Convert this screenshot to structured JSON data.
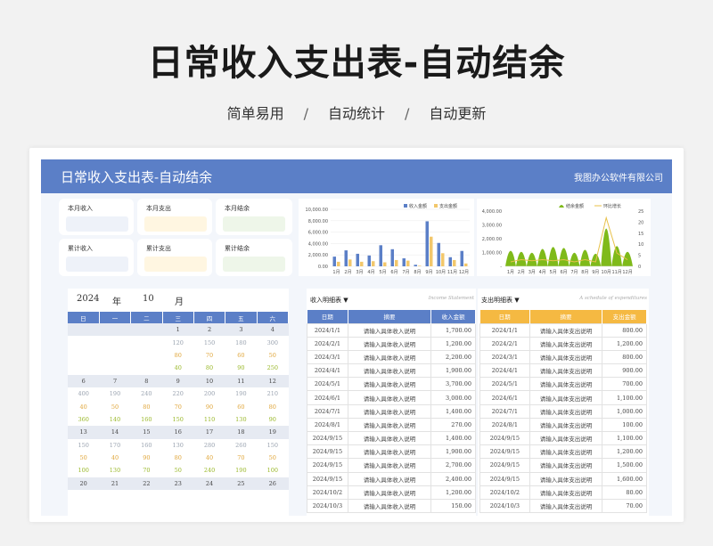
{
  "hero": {
    "title": "日常收入支出表-自动结余",
    "tags": [
      "简单易用",
      "自动统计",
      "自动更新"
    ],
    "sep": "/"
  },
  "banner": {
    "title": "日常收入支出表-自动结余",
    "company": "我图办公软件有限公司"
  },
  "cards": {
    "month_income": "本月收入",
    "month_expense": "本月支出",
    "month_balance": "本月结余",
    "total_income": "累计收入",
    "total_expense": "累计支出",
    "total_balance": "累计结余"
  },
  "colors": {
    "income": "#5b7fc7",
    "expense": "#f2c76b",
    "balance": "#7fba1a",
    "header_blue": "#5b7fc7",
    "header_orange": "#f5b942"
  },
  "chart_data": [
    {
      "type": "bar",
      "legend": [
        "收入金额",
        "支出金额"
      ],
      "categories": [
        "1月",
        "2月",
        "3月",
        "4月",
        "5月",
        "6月",
        "7月",
        "8月",
        "9月",
        "10月",
        "11月",
        "12月"
      ],
      "yticks": [
        "0.00",
        "2,000.00",
        "4,000.00",
        "6,000.00",
        "8,000.00",
        "10,000.00"
      ],
      "ylim": [
        0,
        10000
      ],
      "series": [
        {
          "name": "收入金额",
          "values": [
            1700,
            2800,
            2200,
            1900,
            3700,
            3000,
            1400,
            270,
            7900,
            4100,
            1600,
            2700
          ]
        },
        {
          "name": "支出金额",
          "values": [
            800,
            1200,
            800,
            900,
            700,
            1100,
            1000,
            100,
            5200,
            2300,
            1100,
            500
          ]
        }
      ]
    },
    {
      "type": "area",
      "legend": [
        "结余金额",
        "环比增长"
      ],
      "categories": [
        "1月",
        "2月",
        "3月",
        "4月",
        "5月",
        "6月",
        "7月",
        "8月",
        "9月",
        "10月",
        "11月",
        "12月"
      ],
      "yticks": [
        "-",
        "1,000.00",
        "2,000.00",
        "3,000.00",
        "4,000.00"
      ],
      "y2ticks": [
        "0",
        "5",
        "10",
        "15",
        "20",
        "25"
      ],
      "ylim": [
        0,
        4000
      ],
      "series": [
        {
          "name": "结余金额",
          "values": [
            1600,
            1500,
            1400,
            1800,
            2000,
            1900,
            1400,
            1700,
            1300,
            3900,
            2100,
            1500
          ]
        },
        {
          "name": "环比增长",
          "values": [
            2,
            3,
            2.5,
            3,
            2.5,
            3,
            2,
            3,
            2,
            22,
            6,
            3
          ]
        }
      ]
    }
  ],
  "calendar": {
    "year": "2024",
    "year_label": "年",
    "month": "10",
    "month_label": "月",
    "weekdays": [
      "日",
      "一",
      "二",
      "三",
      "四",
      "五",
      "六"
    ],
    "weeks": [
      {
        "days": [
          "",
          "",
          "",
          "1",
          "2",
          "3",
          "4"
        ],
        "a": [
          "",
          "",
          "",
          "120",
          "150",
          "180",
          "300"
        ],
        "b": [
          "",
          "",
          "",
          "80",
          "70",
          "60",
          "50"
        ],
        "c": [
          "",
          "",
          "",
          "40",
          "80",
          "90",
          "250"
        ]
      },
      {
        "days": [
          "6",
          "7",
          "8",
          "9",
          "10",
          "11",
          "12"
        ],
        "a": [
          "400",
          "190",
          "240",
          "220",
          "200",
          "190",
          "210"
        ],
        "b": [
          "40",
          "50",
          "80",
          "70",
          "90",
          "60",
          "80"
        ],
        "c": [
          "360",
          "140",
          "160",
          "150",
          "110",
          "130",
          "90"
        ]
      },
      {
        "days": [
          "13",
          "14",
          "15",
          "16",
          "17",
          "18",
          "19"
        ],
        "a": [
          "150",
          "170",
          "160",
          "130",
          "280",
          "260",
          "150"
        ],
        "b": [
          "50",
          "40",
          "90",
          "80",
          "40",
          "70",
          "50"
        ],
        "c": [
          "100",
          "130",
          "70",
          "50",
          "240",
          "190",
          "100"
        ]
      },
      {
        "days": [
          "20",
          "21",
          "22",
          "23",
          "24",
          "25",
          "26"
        ],
        "a": [
          "",
          "",
          "",
          "",
          "",
          "",
          ""
        ],
        "b": [
          "",
          "",
          "",
          "",
          "",
          "",
          ""
        ],
        "c": [
          "",
          "",
          "",
          "",
          "",
          "",
          ""
        ]
      }
    ]
  },
  "income": {
    "title": "收入明细表",
    "subtitle": "Income Statement",
    "headers": [
      "日期",
      "摘要",
      "收入金额"
    ],
    "rows": [
      [
        "2024/1/1",
        "请输入具体收入说明",
        "1,700.00"
      ],
      [
        "2024/2/1",
        "请输入具体收入说明",
        "1,200.00"
      ],
      [
        "2024/3/1",
        "请输入具体收入说明",
        "2,200.00"
      ],
      [
        "2024/4/1",
        "请输入具体收入说明",
        "1,900.00"
      ],
      [
        "2024/5/1",
        "请输入具体收入说明",
        "3,700.00"
      ],
      [
        "2024/6/1",
        "请输入具体收入说明",
        "3,000.00"
      ],
      [
        "2024/7/1",
        "请输入具体收入说明",
        "1,400.00"
      ],
      [
        "2024/8/1",
        "请输入具体收入说明",
        "270.00"
      ],
      [
        "2024/9/15",
        "请输入具体收入说明",
        "1,400.00"
      ],
      [
        "2024/9/15",
        "请输入具体收入说明",
        "1,900.00"
      ],
      [
        "2024/9/15",
        "请输入具体收入说明",
        "2,700.00"
      ],
      [
        "2024/9/15",
        "请输入具体收入说明",
        "2,400.00"
      ],
      [
        "2024/10/2",
        "请输入具体收入说明",
        "1,200.00"
      ],
      [
        "2024/10/3",
        "请输入具体收入说明",
        "150.00"
      ]
    ]
  },
  "expense": {
    "title": "支出明细表",
    "subtitle": "A schedule of expenditures",
    "headers": [
      "日期",
      "摘要",
      "支出金额"
    ],
    "rows": [
      [
        "2024/1/1",
        "请输入具体支出说明",
        "800.00"
      ],
      [
        "2024/2/1",
        "请输入具体支出说明",
        "1,200.00"
      ],
      [
        "2024/3/1",
        "请输入具体支出说明",
        "800.00"
      ],
      [
        "2024/4/1",
        "请输入具体支出说明",
        "900.00"
      ],
      [
        "2024/5/1",
        "请输入具体支出说明",
        "700.00"
      ],
      [
        "2024/6/1",
        "请输入具体支出说明",
        "1,100.00"
      ],
      [
        "2024/7/1",
        "请输入具体支出说明",
        "1,000.00"
      ],
      [
        "2024/8/1",
        "请输入具体支出说明",
        "100.00"
      ],
      [
        "2024/9/15",
        "请输入具体支出说明",
        "1,100.00"
      ],
      [
        "2024/9/15",
        "请输入具体支出说明",
        "1,200.00"
      ],
      [
        "2024/9/15",
        "请输入具体支出说明",
        "1,500.00"
      ],
      [
        "2024/9/15",
        "请输入具体支出说明",
        "1,600.00"
      ],
      [
        "2024/10/2",
        "请输入具体支出说明",
        "80.00"
      ],
      [
        "2024/10/3",
        "请输入具体支出说明",
        "70.00"
      ]
    ]
  }
}
